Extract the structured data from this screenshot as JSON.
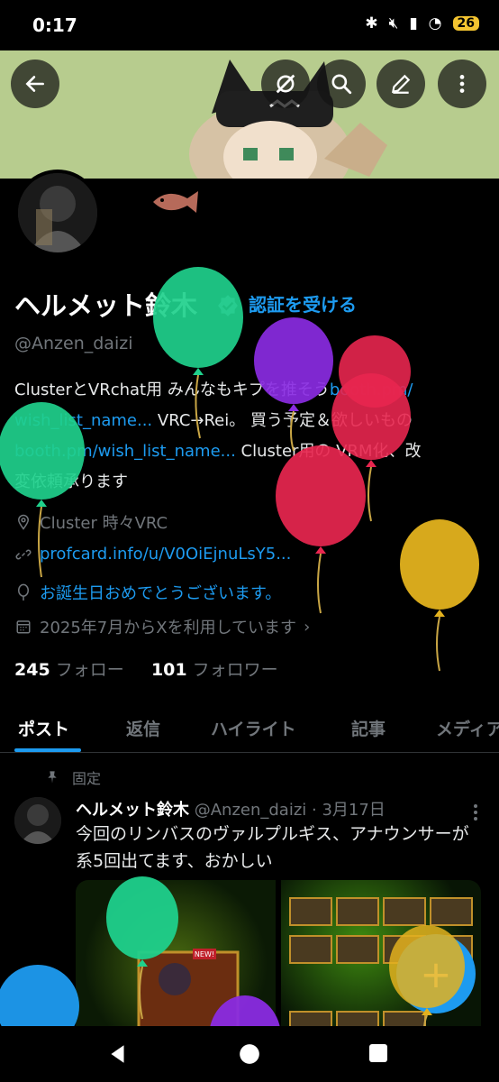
{
  "status_bar": {
    "time": "0:17",
    "battery": "26"
  },
  "profile": {
    "name": "ヘルメット鈴木",
    "verify_label": "認証を受ける",
    "handle": "@Anzen_daizi",
    "bio": {
      "line1_text": "ClusterとVRchat用 みんなもキプを推そう",
      "line1_link": "booth.pm/",
      "line2_link": "wish_list_name...",
      "line2_text": " VRC→Rei。 買う予定＆欲しいもの",
      "line3_link": "booth.pm/wish_list_name...",
      "line3_text": " Cluster用の VRM化、改",
      "line4_text": "変依頼承ります"
    },
    "location": "Cluster 時々VRC",
    "website": "profcard.info/u/V0OiEjnuLsY5...",
    "birthday": "お誕生日おめでとうございます。",
    "joined": "2025年7月からXを利用しています",
    "following_count": "245",
    "following_label": "フォロー",
    "followers_count": "101",
    "followers_label": "フォロワー"
  },
  "tabs": [
    {
      "label": "ポスト"
    },
    {
      "label": "返信"
    },
    {
      "label": "ハイライト"
    },
    {
      "label": "記事"
    },
    {
      "label": "メディア"
    }
  ],
  "post": {
    "pinned_label": "固定",
    "author": "ヘルメット鈴木",
    "handle_date": " @Anzen_daizi · 3月17日",
    "text": "今回のリンバスのヴァルプルギス、アナウンサーが系5回出てます、おかしい",
    "badge": "NEW!"
  },
  "fab": {
    "label": "+"
  },
  "icons": [
    "back-arrow-icon",
    "grok-icon",
    "search-icon",
    "edit-icon",
    "more-vertical-icon",
    "location-icon",
    "link-icon",
    "balloon-icon",
    "calendar-icon",
    "pin-icon",
    "more-horizontal-icon",
    "nav-back-icon",
    "nav-home-icon",
    "nav-recents-icon"
  ],
  "colors": {
    "accent": "#1d9bf0",
    "background": "#000000",
    "banner": "#b7cc8e",
    "balloon_green": "#1fd08c",
    "balloon_purple": "#8a2be2",
    "balloon_red": "#e8264f",
    "balloon_yellow": "#e3b21e",
    "balloon_blue": "#1d9bf0"
  }
}
